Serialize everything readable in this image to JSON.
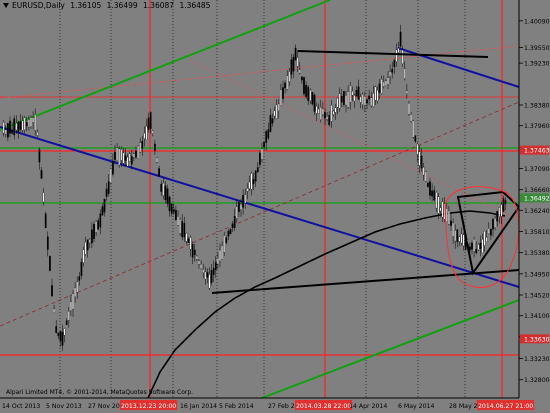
{
  "header": {
    "symbol": "EURUSD,Daily",
    "open": "1.36105",
    "high": "1.36499",
    "low": "1.36087",
    "close": "1.36485"
  },
  "copyright": "Alpari Limited MT4, © 2001-2014, MetaQuotes Software Corp.",
  "price_labels": [
    "1.40090",
    "1.39550",
    "1.39230",
    "1.38380",
    "1.37960",
    "1.37090",
    "1.36660",
    "1.36240",
    "1.35810",
    "1.35380",
    "1.34950",
    "1.34520",
    "1.34100",
    "1.33670",
    "1.33230",
    "1.32800"
  ],
  "price_ticks": [
    1.4009,
    1.3955,
    1.3923,
    1.3838,
    1.3796,
    1.3709,
    1.3666,
    1.3624,
    1.3581,
    1.3538,
    1.3495,
    1.3452,
    1.341,
    1.3367,
    1.3323,
    1.328
  ],
  "price_range": [
    1.3255,
    1.4035
  ],
  "highlight_labels": [
    {
      "text": "1.37463",
      "price": 1.37463,
      "color": "#d03030"
    },
    {
      "text": "1.36492",
      "price": 1.36492,
      "color": "#3a8a3a"
    },
    {
      "text": "1.33630",
      "price": 1.3363,
      "color": "#d03030"
    }
  ],
  "date_labels": [
    "14 Oct 2013",
    "5 Nov 2013",
    "27 Nov 2013",
    "2013.12.23 20:00",
    "16 Jan 2014",
    "5 Feb 2014",
    "27 Feb 2014",
    "2014.03.28 22:00",
    "14 Apr 2014",
    "6 May 2014",
    "28 May 2014",
    "2014.06.27 21:00"
  ],
  "date_label_colors": [
    "#000",
    "#000",
    "#000",
    "#e03030",
    "#000",
    "#000",
    "#000",
    "#e03030",
    "#000",
    "#000",
    "#000",
    "#e03030"
  ],
  "colors": {
    "background": "#808080",
    "bull_candle": "#ffffff",
    "bear_candle": "#000000",
    "red_line": "#ff2020",
    "green_line": "#10a010",
    "blue_line": "#1010a0",
    "black_line": "#000000"
  }
}
